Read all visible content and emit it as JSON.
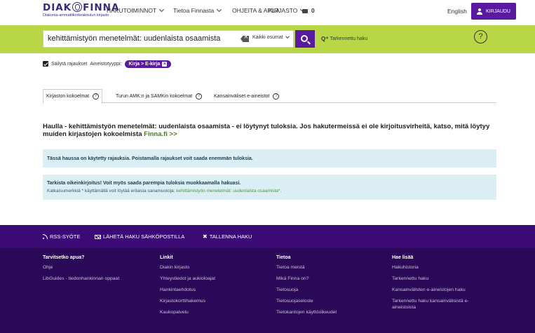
{
  "header": {
    "logo": {
      "main_left": "DIAK",
      "main_right": "FINNA",
      "sub": "Diakonia-ammattikorkeakoulun kirjasto"
    },
    "nav": [
      {
        "label": "HAKUTOIMINNOT",
        "dropdown": true
      },
      {
        "label": "Tietoa Finnasta",
        "dropdown": true
      },
      {
        "label": "OHJEITA & APUA",
        "dropdown": false
      },
      {
        "label": "KIRJASTO",
        "dropdown": true
      }
    ],
    "basket_count": "0",
    "language": "English",
    "login_label": "KIRJAUDU"
  },
  "search": {
    "query": "kehittämistyön menetelmät: uudenlaista osaamista",
    "scope": "Kaikki osumat",
    "advanced_label": "Tarkennettu haku",
    "help_symbol": "?"
  },
  "filters": {
    "keep_label": "Säilytä rajaukset",
    "type_label": "Aineistotyyppi:",
    "chip_label": "Kirja > E-kirja"
  },
  "tabs": [
    {
      "label": "Kirjaston kokoelmat",
      "active": true
    },
    {
      "label": "Turun AMK:n ja SAMKin kokoelmat",
      "active": false
    },
    {
      "label": "Kansainväliset e-aineistot",
      "active": false
    }
  ],
  "results": {
    "no_results_text": "Haulla - kehittämistyön menetelmät: uudenlaista osaamista - ei löytynyt tuloksia. Jos hakutermeissä ei ole kirjoitusvirheitä, katso, mitä löytyy muiden kirjastojen kokoelmista",
    "finna_link": "Finna.fi >>",
    "info1": "Tässä haussa on käytetty rajauksia. Poistamalla rajaukset voit saada enemmän tuloksia.",
    "info2_title": "Tarkista oikeinkirjoitus! Voit myös saada parempia tuloksia muokkaamalla hakuasi.",
    "info2_text": "Katkaisumerkkiä * käyttämällä voit löytää erilaisia sanamuotoja:",
    "info2_link": "kehittämistyön menetelmät: uudenlaista osaamista*",
    "info2_tail": "."
  },
  "footer": {
    "actions": [
      {
        "label": "RSS-SYÖTE",
        "icon": "rss-icon"
      },
      {
        "label": "LÄHETÄ HAKU SÄHKÖPOSTILLA",
        "icon": "mail-icon"
      },
      {
        "label": "TALLENNA HAKU",
        "icon": "pin-icon"
      }
    ],
    "columns": [
      {
        "title": "Tarvitsetko apua?",
        "links": [
          "Ohje",
          "LibGuides - tiedonhankinnan oppaat"
        ]
      },
      {
        "title": "Linkit",
        "links": [
          "Diakin kirjasto",
          "Yhteystiedot ja aukioloajat",
          "Hankintaehdotus",
          "Kirjastokorttihakemus",
          "Kaukopalvelu"
        ]
      },
      {
        "title": "Tietoa",
        "links": [
          "Tietoa meistä",
          "Mikä Finna on?",
          "Tietosuoja",
          "Tietosuojaseloste",
          "Tietokantojen käyttöoikeudet"
        ]
      },
      {
        "title": "Hae lisää",
        "links": [
          "Hakuhistoria",
          "Tarkennettu haku",
          "Kansainvälisten e-aineistojen haku",
          "Tarkennettu haku kansainvälisistä e-aineistoista"
        ]
      }
    ]
  },
  "colors": {
    "accent_purple": "#5a1aa0",
    "search_green": "#b8d646",
    "footer_purple": "#2b0858"
  }
}
